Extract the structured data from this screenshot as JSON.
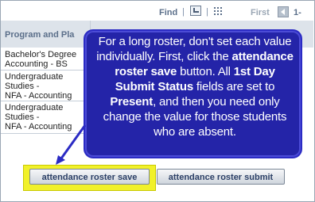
{
  "toolbar": {
    "find_label": "Find",
    "separator": "|",
    "first_label": "First",
    "range_label": "1-",
    "view_icon": "view-all-icon",
    "download_icon": "download-grid-icon",
    "prev_icon": "previous-arrow-icon"
  },
  "grid": {
    "column_header": "Program and Pla",
    "rows": [
      {
        "line1": "Bachelor's Degree",
        "line2": "Accounting - BS",
        "line3": ""
      },
      {
        "line1": "Undergraduate",
        "line2": "Studies -",
        "line3": "NFA - Accounting"
      },
      {
        "line1": "Undergraduate",
        "line2": "Studies -",
        "line3": "NFA - Accounting"
      }
    ]
  },
  "callout": {
    "t1": "For a long roster, don't set each value individually. First, click the",
    "t2": "attendance roster save",
    "t3": " button. All ",
    "t4": "1st Day Submit Status",
    "t5": " fields are set to ",
    "t6": "Present",
    "t7": ", and then you need only change the value for those students who are absent."
  },
  "buttons": {
    "save_label": "attendance roster save",
    "submit_label": "attendance roster submit"
  },
  "colors": {
    "callout_bg": "#2424a8",
    "highlight": "#f1f12a",
    "header_bg": "#dde3ea"
  }
}
